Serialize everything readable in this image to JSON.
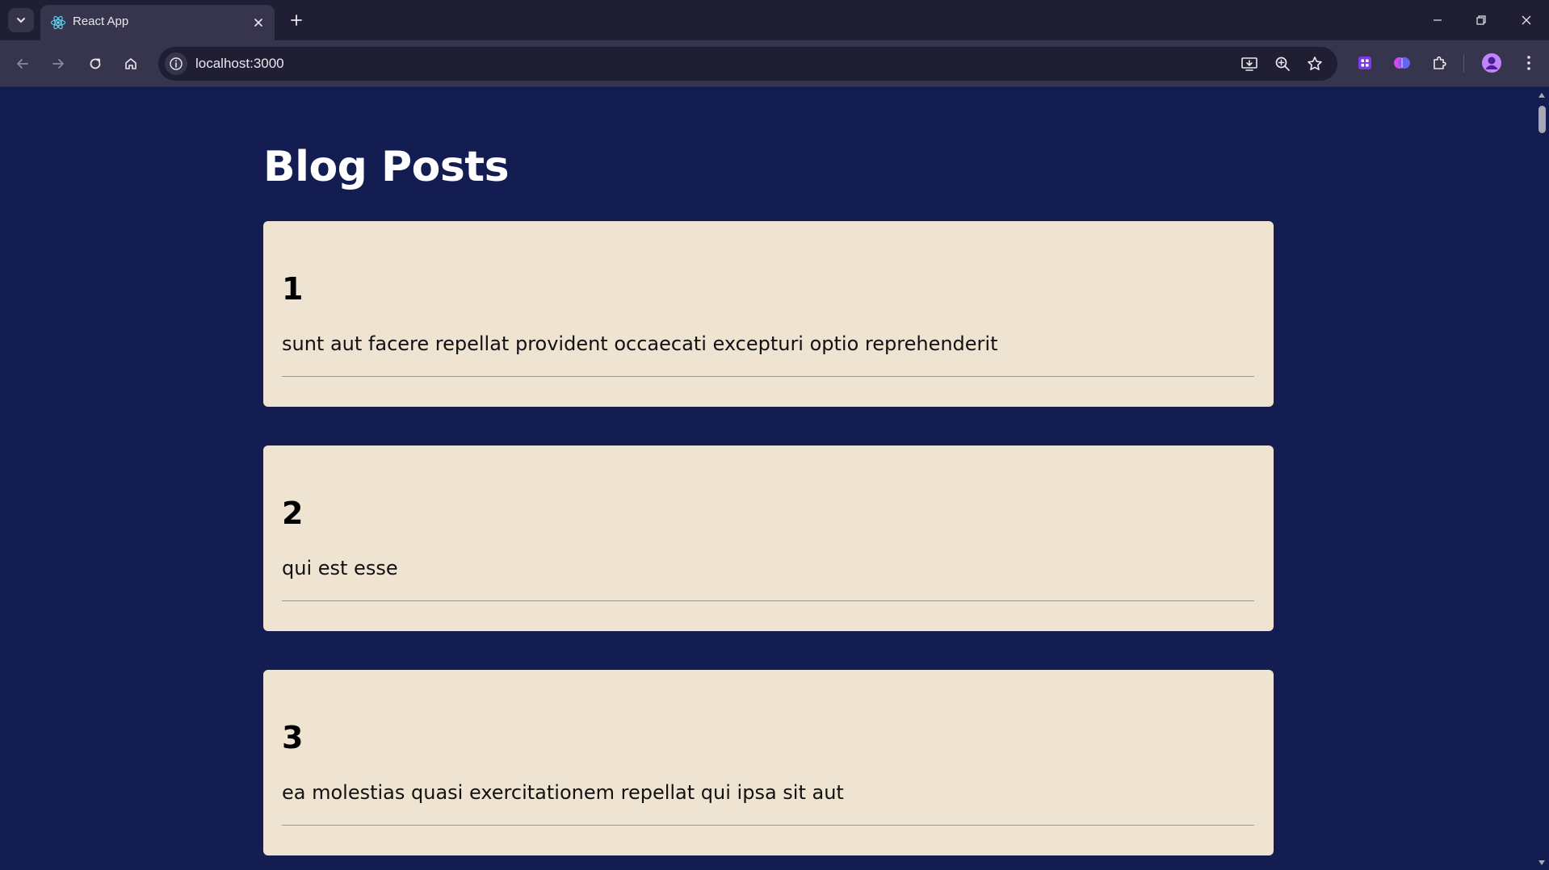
{
  "browser": {
    "tab_title": "React App",
    "url": "localhost:3000",
    "icons": {
      "tab_search": "chevron-down-icon",
      "favicon": "react-icon",
      "tab_close": "close-icon",
      "new_tab": "plus-icon",
      "back": "arrow-left-icon",
      "forward": "arrow-right-icon",
      "reload": "reload-icon",
      "home": "home-icon",
      "site_info": "info-icon",
      "install": "install-app-icon",
      "zoom": "zoom-icon",
      "bookmark": "star-icon",
      "extensions": "puzzle-icon",
      "profile": "avatar",
      "menu": "kebab-menu-icon"
    },
    "window_controls": [
      "minimize",
      "restore",
      "close"
    ]
  },
  "page": {
    "heading": "Blog Posts",
    "background_color": "#141d52",
    "card_color": "#efe3d2",
    "posts": [
      {
        "id": "1",
        "title": "sunt aut facere repellat provident occaecati excepturi optio reprehenderit"
      },
      {
        "id": "2",
        "title": "qui est esse"
      },
      {
        "id": "3",
        "title": "ea molestias quasi exercitationem repellat qui ipsa sit aut"
      }
    ]
  }
}
